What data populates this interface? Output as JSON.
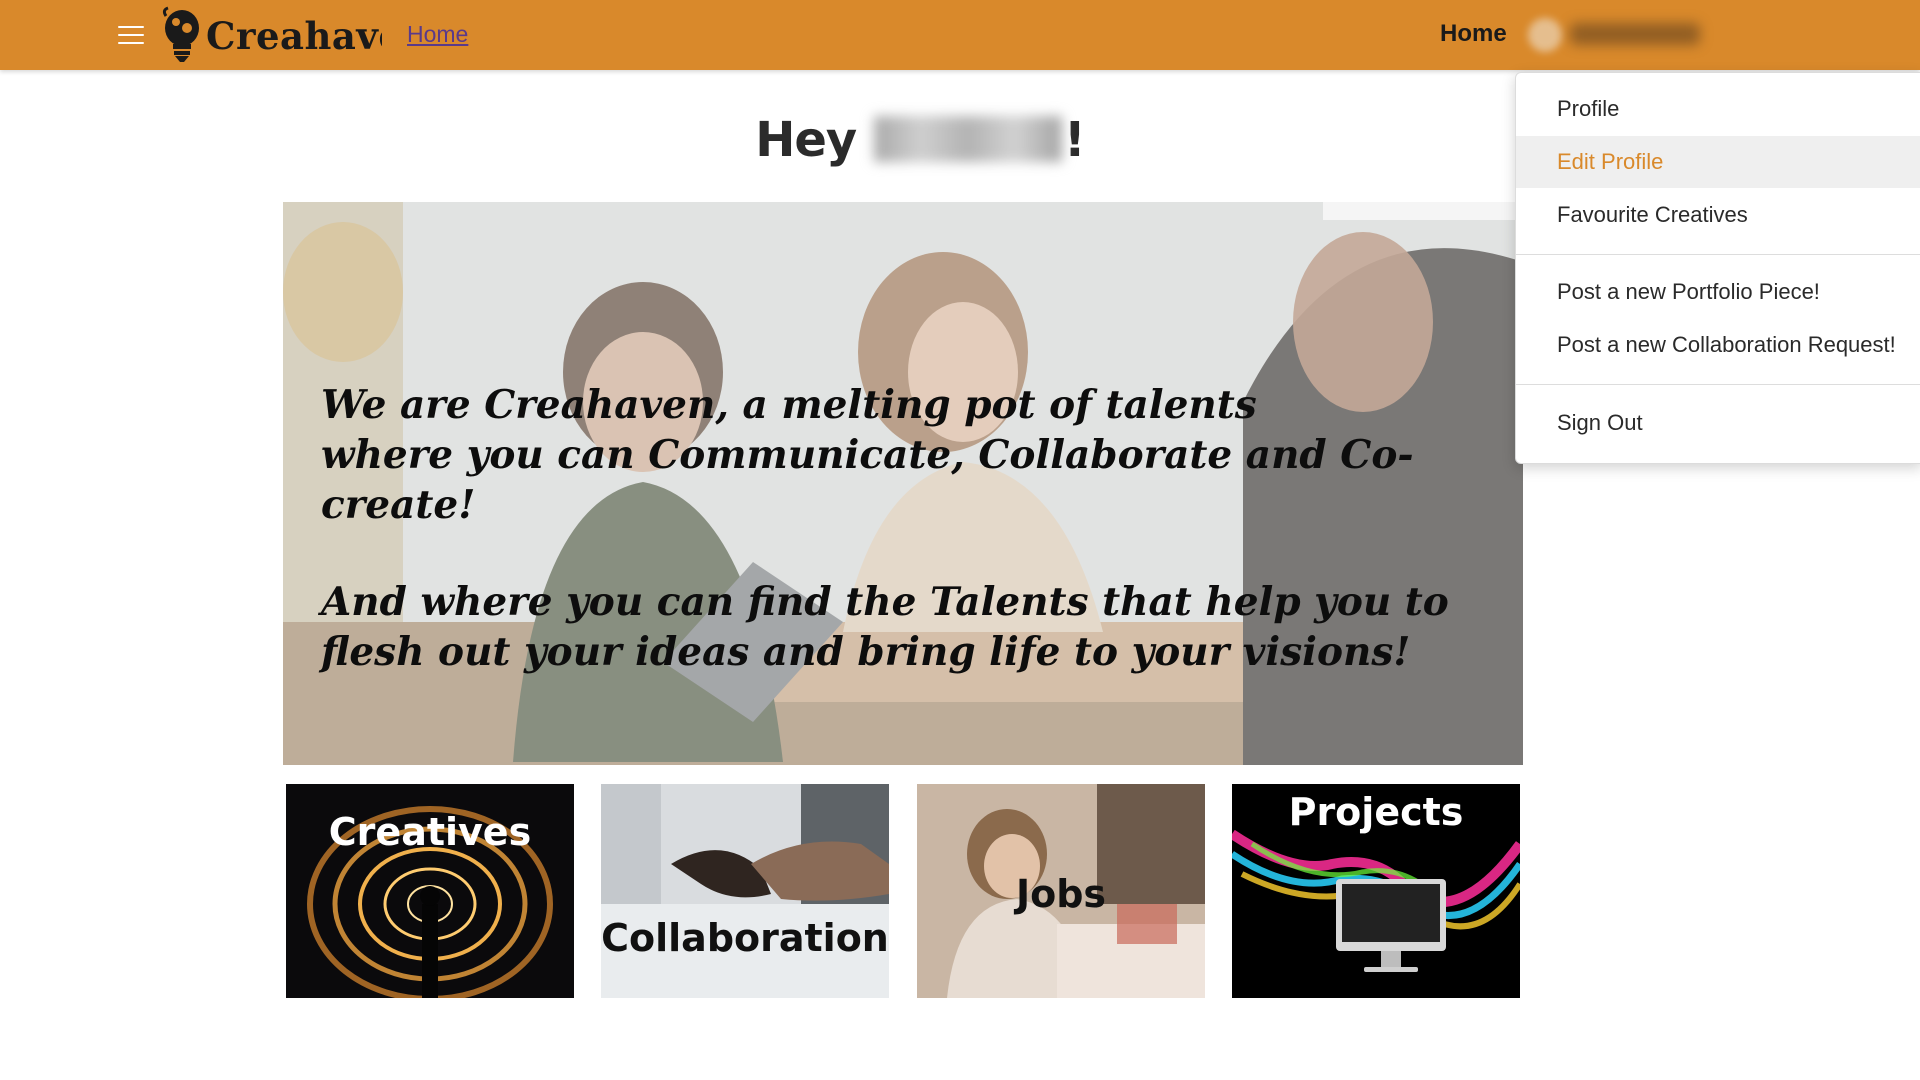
{
  "navbar": {
    "brand": "Creahaven",
    "home_link": "Home",
    "home_right": "Home"
  },
  "greeting": {
    "prefix": "Hey",
    "suffix": "!"
  },
  "hero": {
    "line1": "We are Creahaven, a melting pot of talents",
    "line2": "where you can Communicate, Collaborate and Co-create!",
    "line3": "And where you can find the Talents that help you to",
    "line4": "flesh out your ideas and bring life to your visions!"
  },
  "tiles": [
    {
      "label": "Creatives"
    },
    {
      "label": "Collaboration"
    },
    {
      "label": "Jobs"
    },
    {
      "label": "Projects"
    }
  ],
  "dropdown": {
    "items": [
      {
        "label": "Profile",
        "active": false
      },
      {
        "label": "Edit Profile",
        "active": true
      },
      {
        "label": "Favourite Creatives",
        "active": false
      },
      {
        "label": "Post a new Portfolio Piece!",
        "active": false
      },
      {
        "label": "Post a new Collaboration Request!",
        "active": false
      },
      {
        "label": "Sign Out",
        "active": false
      }
    ]
  },
  "colors": {
    "navbar": "#d9892b",
    "active_item_text": "#d9892b",
    "active_item_bg": "#efefef"
  },
  "icons": [
    "hamburger-menu-icon",
    "lightbulb-logo-icon",
    "user-avatar-icon"
  ]
}
